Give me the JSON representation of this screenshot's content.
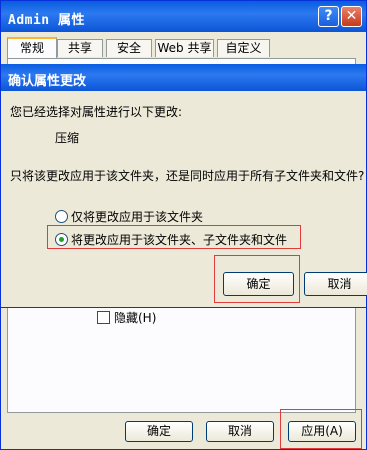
{
  "window": {
    "title": "Admin 属性",
    "help_glyph": "?",
    "close_glyph": "✕",
    "tabs": [
      {
        "label": "常规",
        "active": true
      },
      {
        "label": "共享",
        "active": false
      },
      {
        "label": "安全",
        "active": false
      },
      {
        "label": "Web 共享",
        "active": false
      },
      {
        "label": "自定义",
        "active": false
      }
    ],
    "hidden_checkbox": {
      "label": "隐藏(H)",
      "checked": false
    },
    "buttons": {
      "ok": "确定",
      "cancel": "取消",
      "apply": "应用(A)"
    }
  },
  "dialog": {
    "title": "确认属性更改",
    "intro": "您已经选择对属性进行以下更改:",
    "change": "压缩",
    "question": "只将该更改应用于该文件夹，还是同时应用于所有子文件夹和文件?",
    "options": [
      {
        "label": "仅将更改应用于该文件夹",
        "selected": false
      },
      {
        "label": "将更改应用于该文件夹、子文件夹和文件",
        "selected": true
      }
    ],
    "buttons": {
      "ok": "确定",
      "cancel": "取消"
    }
  },
  "highlight_color": "#e23b3b"
}
